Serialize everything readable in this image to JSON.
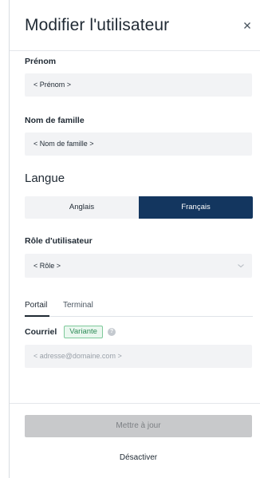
{
  "panel": {
    "title": "Modifier l'utilisateur",
    "close_icon": "close-icon"
  },
  "first_name": {
    "label": "Prénom",
    "value": "< Prénom >"
  },
  "last_name": {
    "label": "Nom de famille",
    "value": "< Nom de famille >"
  },
  "language": {
    "title": "Langue",
    "options": [
      "Anglais",
      "Français"
    ],
    "selected": "Français"
  },
  "role": {
    "label": "Rôle d'utilisateur",
    "value": "< Rôle >",
    "icon": "chevron-down-icon"
  },
  "tabs": {
    "items": [
      "Portail",
      "Terminal"
    ],
    "active": "Portail"
  },
  "email": {
    "label": "Courriel",
    "badge": "Variante",
    "help_icon": "help-icon",
    "placeholder": "< adresse@domaine.com >"
  },
  "actions": {
    "submit_label": "Mettre à jour",
    "deactivate_label": "Désactiver"
  },
  "colors": {
    "accent": "#13365f",
    "badge_green": "#2e8b57",
    "disabled_button": "#c8c9cb"
  }
}
